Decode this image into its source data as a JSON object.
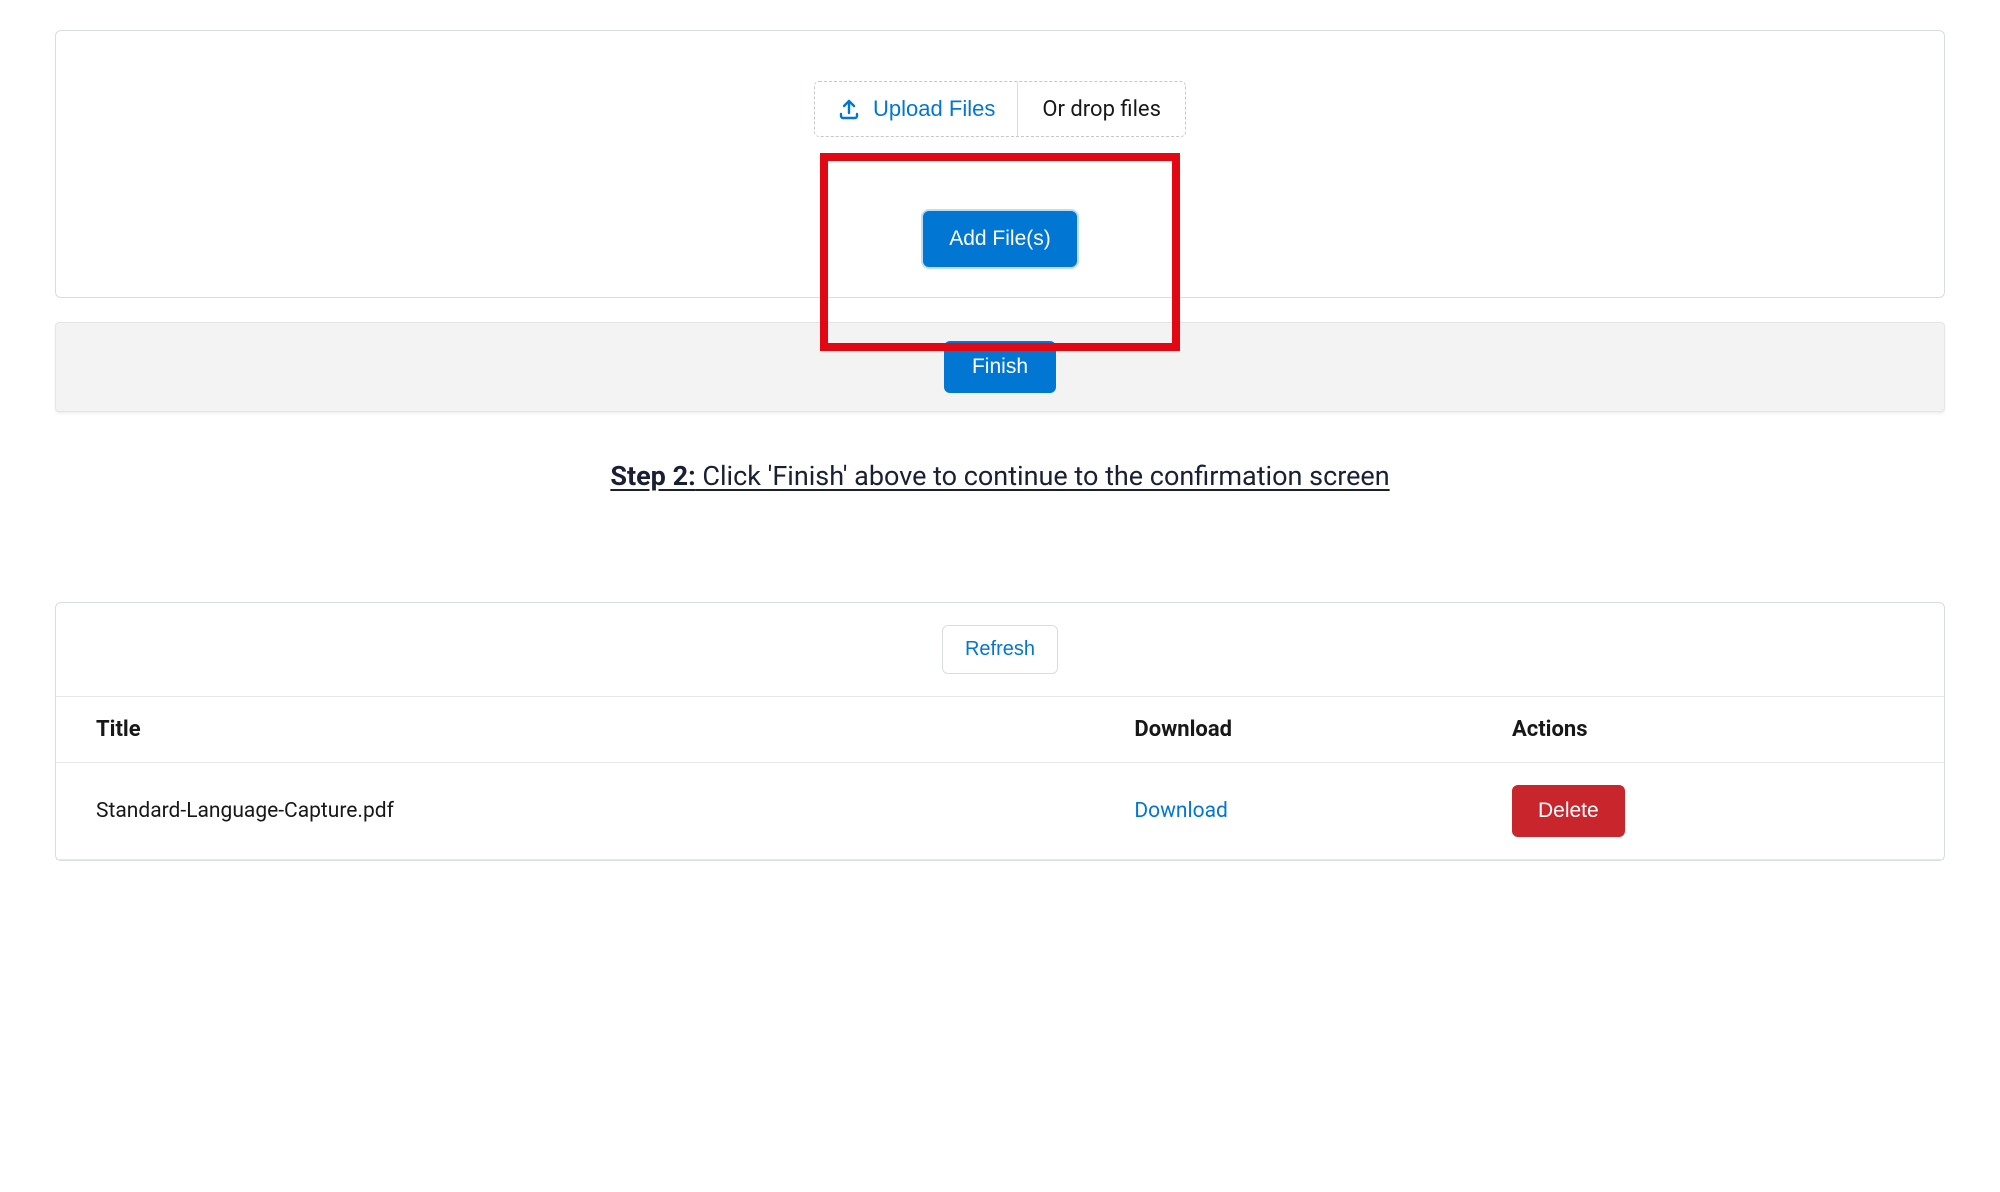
{
  "upload": {
    "button_label": "Upload Files",
    "drop_label": "Or drop files",
    "add_file_label": "Add File(s)"
  },
  "footer": {
    "finish_label": "Finish"
  },
  "step": {
    "label": "Step 2:",
    "instruction": " Click 'Finish' above to continue to the confirmation screen"
  },
  "files_panel": {
    "refresh_label": "Refresh",
    "columns": {
      "title": "Title",
      "download": "Download",
      "actions": "Actions"
    },
    "rows": [
      {
        "title": "Standard-Language-Capture.pdf",
        "download_label": "Download",
        "delete_label": "Delete"
      }
    ]
  },
  "colors": {
    "primary": "#0176d3",
    "danger": "#c9252d",
    "highlight": "#e30613"
  }
}
